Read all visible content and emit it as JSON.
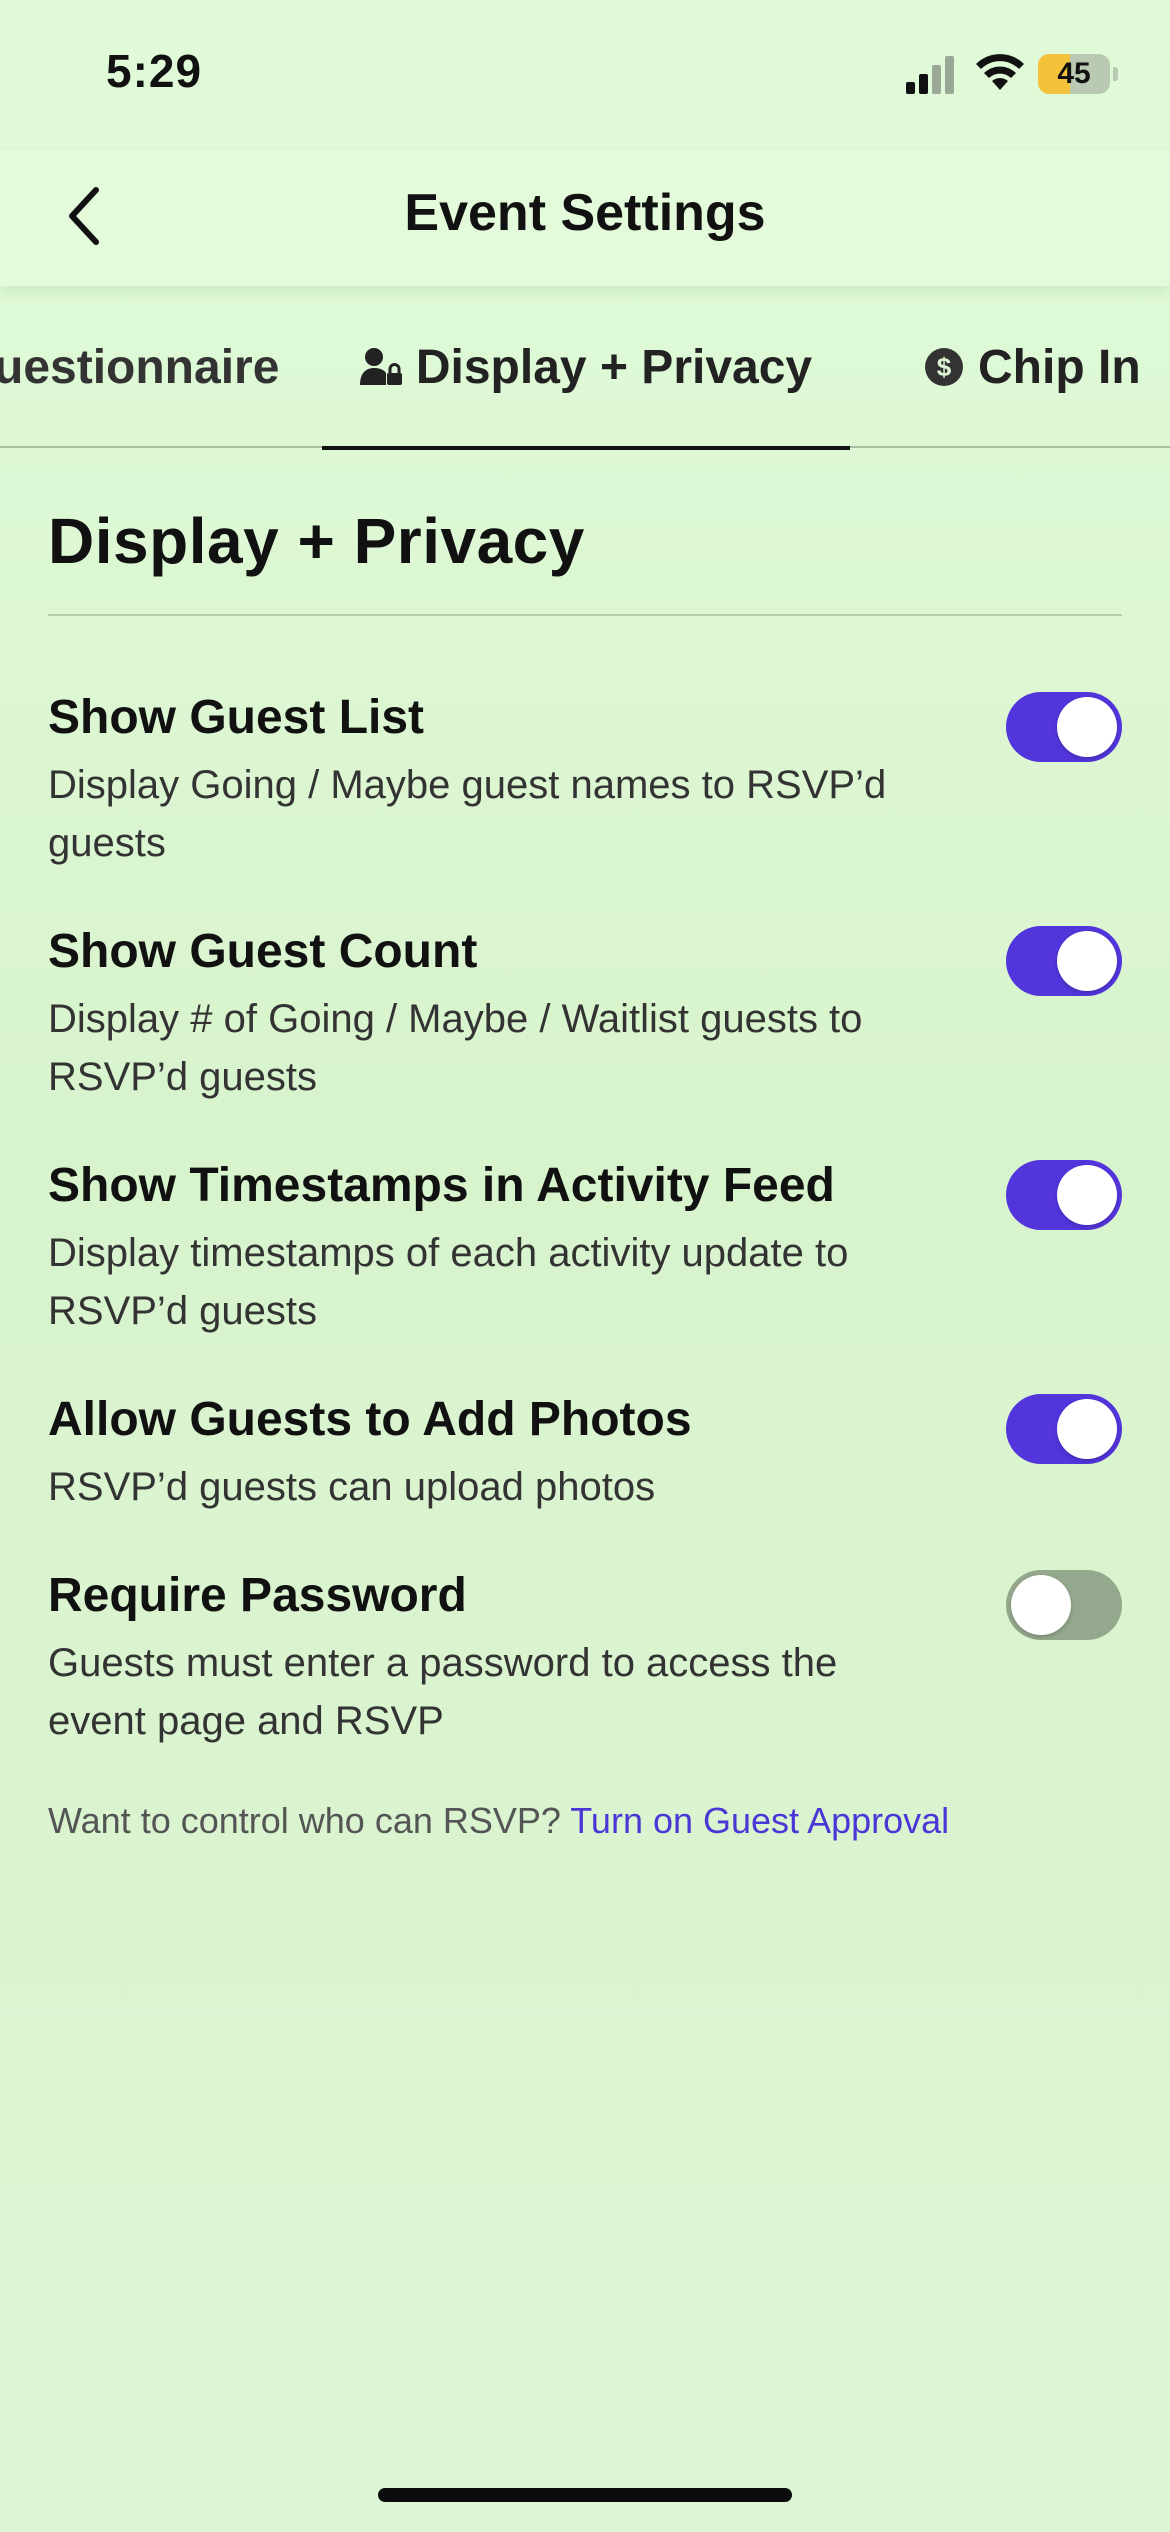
{
  "status_bar": {
    "time": "5:29",
    "battery_level": "45",
    "battery_fraction": 0.45,
    "icons": [
      "cellular-signal-icon",
      "wifi-icon",
      "battery-icon"
    ]
  },
  "header": {
    "title": "Event Settings",
    "back_icon": "chevron-left-icon"
  },
  "tabs": [
    {
      "label": "uestionnaire",
      "active": false
    },
    {
      "label": "Display + Privacy",
      "active": true,
      "icon": "person-lock-icon"
    },
    {
      "label": "Chip In",
      "active": false,
      "icon": "dollar-circle-icon"
    }
  ],
  "section": {
    "title": "Display + Privacy"
  },
  "settings": [
    {
      "title": "Show Guest List",
      "description": "Display Going / Maybe guest names to RSVP’d guests",
      "enabled": true
    },
    {
      "title": "Show Guest Count",
      "description": "Display # of Going / Maybe / Waitlist guests to RSVP’d guests",
      "enabled": true
    },
    {
      "title": "Show Timestamps in Activity Feed",
      "description": "Display timestamps of each activity update to RSVP’d guests",
      "enabled": true
    },
    {
      "title": "Allow Guests to Add Photos",
      "description": "RSVP’d guests can upload photos",
      "enabled": true
    },
    {
      "title": "Require Password",
      "description": "Guests must enter a password to access the event page and RSVP",
      "enabled": false
    }
  ],
  "footer": {
    "prompt": "Want to control who can RSVP?",
    "link": "Turn on Guest Approval"
  },
  "colors": {
    "accent": "#5335dc",
    "toggle_off": "#93a88c",
    "background": "#dcf5d3",
    "battery_fill": "#f5c33b"
  }
}
